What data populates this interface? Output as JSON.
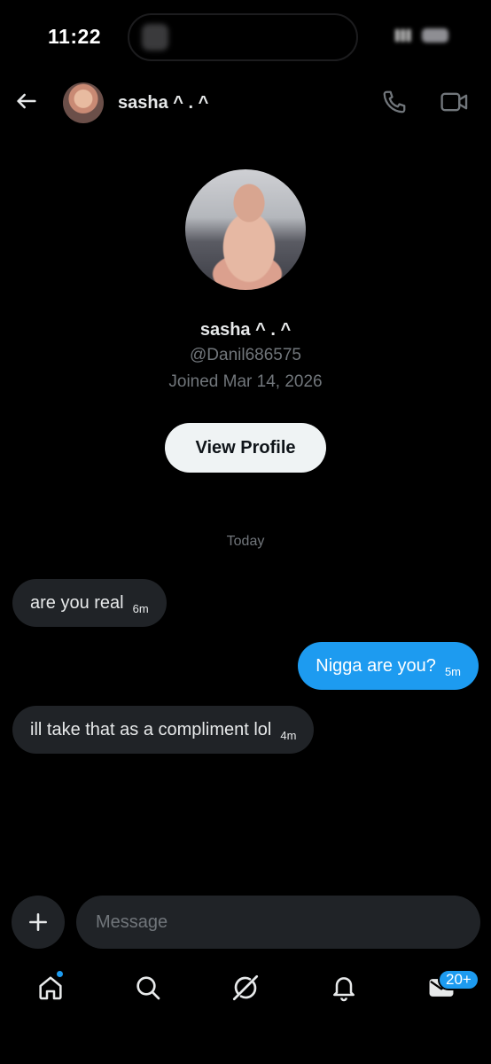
{
  "status_bar": {
    "time": "11:22"
  },
  "header": {
    "name": "sasha ^ . ^"
  },
  "profile": {
    "name": "sasha ^ . ^",
    "handle": "@Danil686575",
    "joined": "Joined Mar 14, 2026",
    "view_profile_label": "View Profile"
  },
  "conversation": {
    "date_divider": "Today",
    "messages": [
      {
        "direction": "incoming",
        "text": "are you real",
        "time": "6m"
      },
      {
        "direction": "outgoing",
        "text": "Nigga are you?",
        "time": "5m"
      },
      {
        "direction": "incoming",
        "text": "ill take that as a compliment lol",
        "time": "4m"
      }
    ]
  },
  "composer": {
    "placeholder": "Message"
  },
  "bottom_nav": {
    "items": [
      "home-icon",
      "search-icon",
      "grok-icon",
      "bell-icon",
      "mail-icon"
    ],
    "messages_badge": "20+"
  },
  "colors": {
    "accent": "#1d9bf0",
    "bubble_incoming": "#202327",
    "background": "#000000",
    "muted_text": "#71767b"
  }
}
